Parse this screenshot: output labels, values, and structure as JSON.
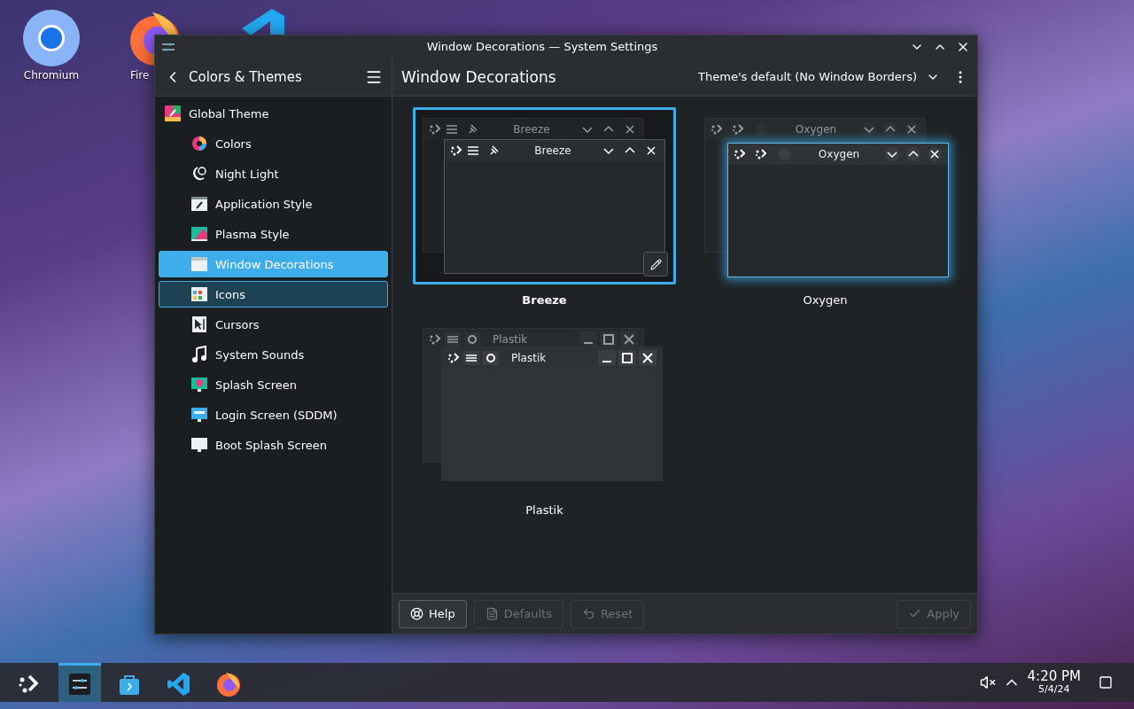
{
  "desktop_icons": [
    {
      "kind": "chromium",
      "label": "Chromium"
    },
    {
      "kind": "firefox",
      "label": "Fire"
    },
    {
      "kind": "vscode"
    }
  ],
  "window": {
    "title": "Window Decorations — System Settings"
  },
  "sidebar": {
    "title": "Colors & Themes",
    "items": [
      {
        "label": "Global Theme",
        "kind": "global",
        "selected": false,
        "hovered": false,
        "children": [
          {
            "label": "Colors",
            "kind": "colors",
            "selected": false,
            "hovered": false
          },
          {
            "label": "Night Light",
            "kind": "night",
            "selected": false,
            "hovered": false
          },
          {
            "label": "Application Style",
            "kind": "appstyle",
            "selected": false,
            "hovered": false
          },
          {
            "label": "Plasma Style",
            "kind": "plasma",
            "selected": false,
            "hovered": false
          },
          {
            "label": "Window Decorations",
            "kind": "windeco",
            "selected": true,
            "hovered": false
          },
          {
            "label": "Icons",
            "kind": "icons",
            "selected": false,
            "hovered": true
          },
          {
            "label": "Cursors",
            "kind": "cursors",
            "selected": false,
            "hovered": false
          },
          {
            "label": "System Sounds",
            "kind": "sounds",
            "selected": false,
            "hovered": false
          },
          {
            "label": "Splash Screen",
            "kind": "splash",
            "selected": false,
            "hovered": false
          },
          {
            "label": "Login Screen (SDDM)",
            "kind": "login",
            "selected": false,
            "hovered": false
          },
          {
            "label": "Boot Splash Screen",
            "kind": "boot",
            "selected": false,
            "hovered": false
          }
        ]
      }
    ]
  },
  "content": {
    "title": "Window Decorations",
    "border_size": "Theme's default (No Window Borders)",
    "themes": [
      {
        "name": "Breeze",
        "kind": "breeze",
        "back_title": "Breeze",
        "front_title": "Breeze",
        "selected": true
      },
      {
        "name": "Oxygen",
        "kind": "oxygen",
        "back_title": "Oxygen",
        "front_title": "Oxygen",
        "selected": false
      },
      {
        "name": "Plastik",
        "kind": "plastik",
        "back_title": "Plastik",
        "front_title": "Plastik",
        "selected": false
      }
    ]
  },
  "footer": {
    "buttons": [
      {
        "label": "Help",
        "kind": "help",
        "disabled": false
      },
      {
        "label": "Defaults",
        "kind": "defaults",
        "disabled": true
      },
      {
        "label": "Reset",
        "kind": "reset",
        "disabled": true
      }
    ],
    "apply": {
      "label": "Apply",
      "disabled": true
    }
  },
  "taskbar": {
    "items": [
      {
        "kind": "launcher",
        "selected": false
      },
      {
        "kind": "settings",
        "selected": true
      },
      {
        "kind": "discover",
        "selected": false
      },
      {
        "kind": "vscode",
        "selected": false
      },
      {
        "kind": "firefox",
        "selected": false
      }
    ],
    "tray": {
      "volume_muted": true
    },
    "time": "4:20 PM",
    "date": "5/4/24"
  }
}
